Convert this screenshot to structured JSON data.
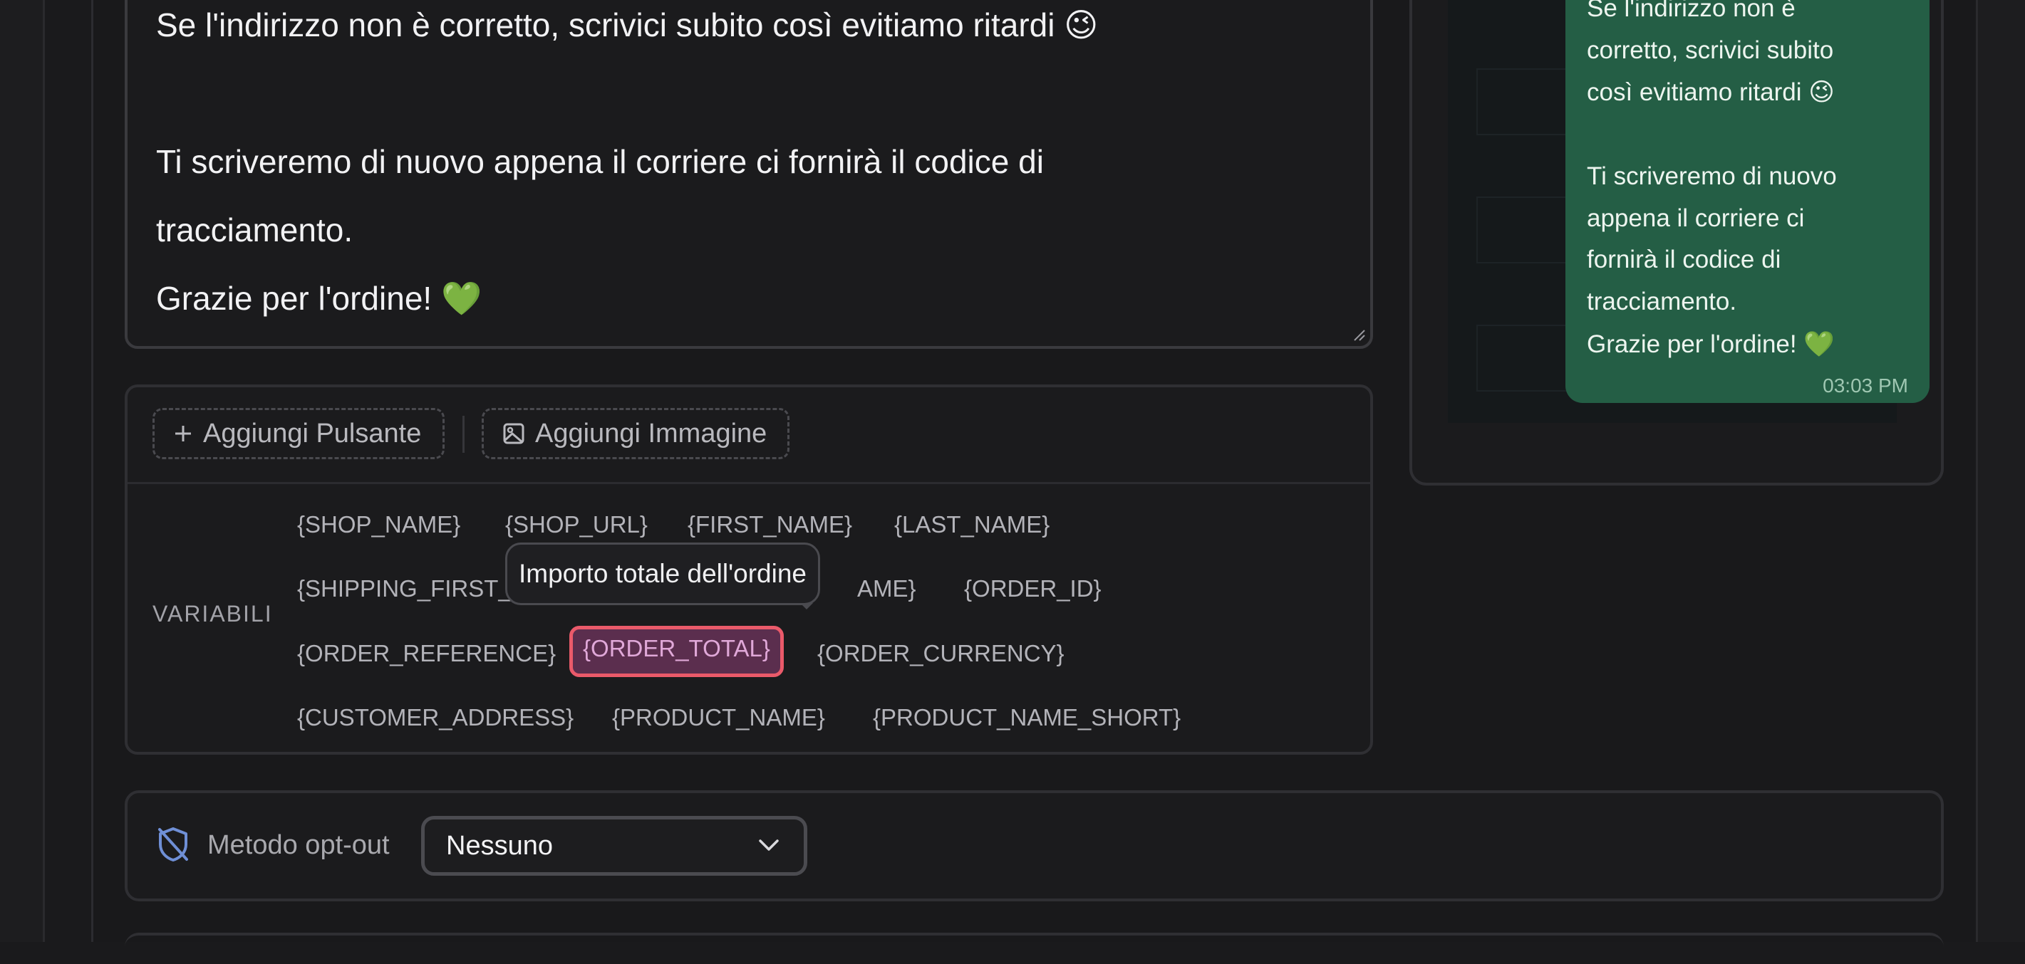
{
  "message": {
    "lines": [
      "Se l'indirizzo non è corretto, scrivici subito così evitiamo ritardi 😉",
      "Ti scriveremo di nuovo appena il corriere ci fornirà il codice di",
      "tracciamento.",
      "Grazie per l'ordine! 💚"
    ]
  },
  "toolbar": {
    "add_button_label": "Aggiungi Pulsante",
    "add_image_label": "Aggiungi Immagine"
  },
  "variables": {
    "label": "VARIABILI",
    "items": [
      "{SHOP_NAME}",
      "{SHOP_URL}",
      "{FIRST_NAME}",
      "{LAST_NAME}",
      "{SHIPPING_FIRST_",
      "AME}",
      "{ORDER_ID}",
      "{ORDER_REFERENCE}",
      "{ORDER_TOTAL}",
      "{ORDER_CURRENCY}",
      "{CUSTOMER_ADDRESS}",
      "{PRODUCT_NAME}",
      "{PRODUCT_NAME_SHORT}"
    ],
    "active": "{ORDER_TOTAL}",
    "tooltip": "Importo totale dell'ordine"
  },
  "preview": {
    "lines": [
      "Se l'indirizzo non è",
      "corretto, scrivici subito",
      "così evitiamo ritardi 😉",
      "Ti scriveremo di nuovo",
      "appena il corriere ci",
      "fornirà il codice di",
      "tracciamento.",
      "Grazie per l'ordine! 💚"
    ],
    "time": "03:03 PM"
  },
  "optout": {
    "label": "Metodo opt-out",
    "selected": "Nessuno"
  },
  "icons": {
    "plus": "plus-icon",
    "image": "image-icon",
    "shield_off": "shield-off-icon",
    "chevron": "chevron-down-icon"
  },
  "colors": {
    "accent": "#ea5a6a",
    "bubble": "#245e45",
    "shield_icon": "#6f8fd6"
  }
}
